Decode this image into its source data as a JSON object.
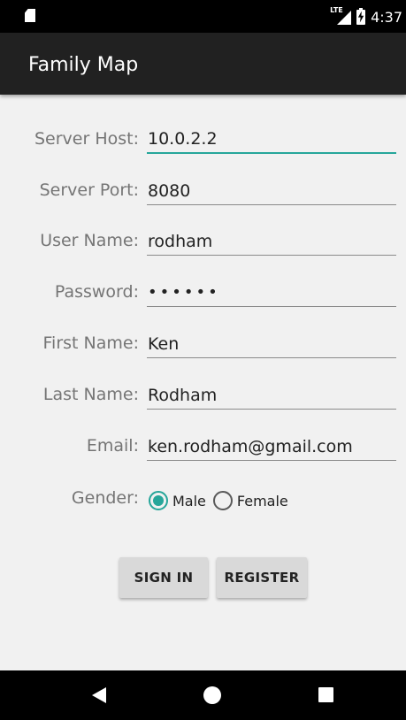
{
  "status_bar": {
    "icons": [
      "sd-card-icon",
      "lte-signal-icon",
      "battery-charging-icon"
    ],
    "network": "LTE",
    "time": "4:37"
  },
  "app_bar": {
    "title": "Family Map"
  },
  "form": {
    "server_host": {
      "label": "Server Host:",
      "value": "10.0.2.2"
    },
    "server_port": {
      "label": "Server Port:",
      "value": "8080"
    },
    "user_name": {
      "label": "User Name:",
      "value": "rodham"
    },
    "password": {
      "label": "Password:",
      "value": "••••••"
    },
    "first_name": {
      "label": "First Name:",
      "value": "Ken"
    },
    "last_name": {
      "label": "Last Name:",
      "value": "Rodham"
    },
    "email": {
      "label": "Email:",
      "value": "ken.rodham@gmail.com"
    },
    "gender": {
      "label": "Gender:",
      "options": [
        "Male",
        "Female"
      ],
      "selected": "Male"
    }
  },
  "buttons": {
    "sign_in": "SIGN IN",
    "register": "REGISTER"
  },
  "nav_bar": {
    "icons": [
      "back-icon",
      "home-icon",
      "recents-icon"
    ]
  },
  "colors": {
    "accent": "#26a69a",
    "app_bar": "#212121",
    "background": "#f1f1f1"
  }
}
